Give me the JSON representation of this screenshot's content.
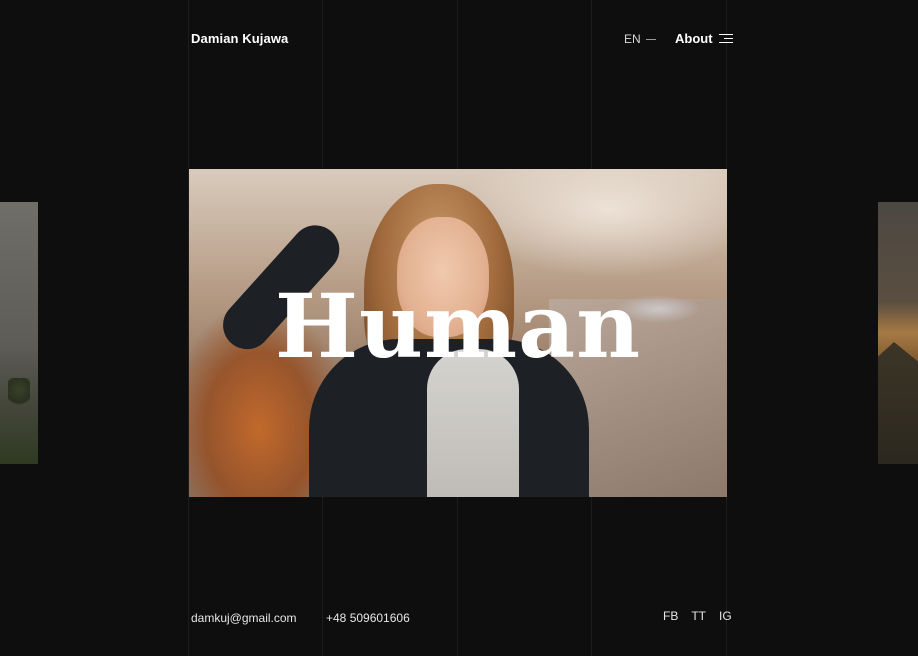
{
  "header": {
    "brand": "Damian Kujawa",
    "language": "EN",
    "about_label": "About"
  },
  "hero": {
    "title": "Human"
  },
  "footer": {
    "email": "damkuj@gmail.com",
    "phone": "+48 509601606",
    "socials": [
      "FB",
      "TT",
      "IG"
    ]
  },
  "colors": {
    "background": "#0e0e0e",
    "text": "#ffffff"
  },
  "icons": {
    "menu": "hamburger-menu-icon",
    "language_indicator": "dash"
  }
}
